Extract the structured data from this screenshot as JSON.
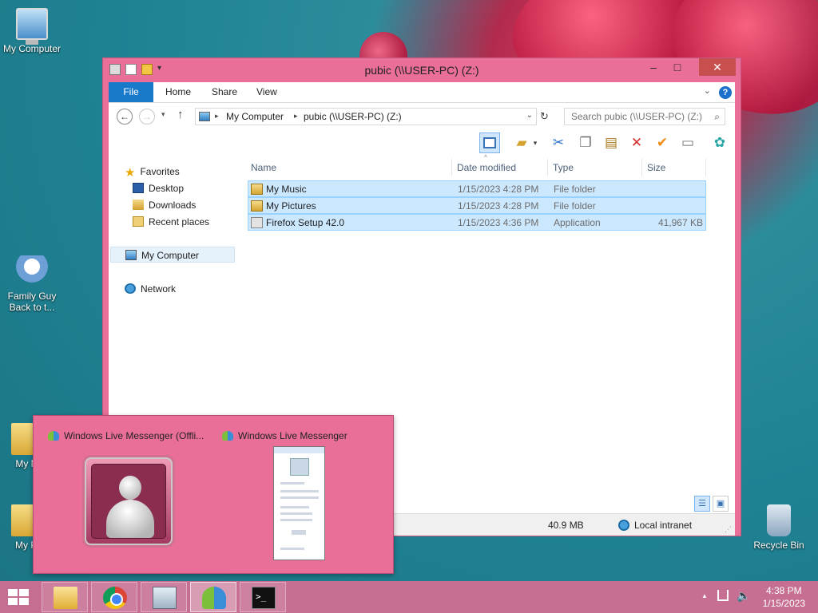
{
  "desktop": {
    "icons": [
      {
        "label": "My Computer"
      },
      {
        "label": "Family Guy Back to t..."
      },
      {
        "label": "My M"
      },
      {
        "label": "My Pi"
      },
      {
        "label": "Recycle Bin"
      }
    ]
  },
  "explorer": {
    "title": "pubic (\\\\USER-PC) (Z:)",
    "ribbon_tabs": [
      "File",
      "Home",
      "Share",
      "View"
    ],
    "address": {
      "parts": [
        "My Computer",
        "pubic (\\\\USER-PC) (Z:)"
      ]
    },
    "search": {
      "placeholder": "Search pubic (\\\\USER-PC) (Z:)"
    },
    "nav_pane": {
      "favorites": "Favorites",
      "desktop": "Desktop",
      "downloads": "Downloads",
      "recent": "Recent places",
      "computer": "My Computer",
      "network": "Network"
    },
    "columns": [
      "Name",
      "Date modified",
      "Type",
      "Size"
    ],
    "files": [
      {
        "name": "My Music",
        "date": "1/15/2023 4:28 PM",
        "type": "File folder",
        "size": "",
        "icon": "music-folder-icon"
      },
      {
        "name": "My Pictures",
        "date": "1/15/2023 4:28 PM",
        "type": "File folder",
        "size": "",
        "icon": "pictures-folder-icon"
      },
      {
        "name": "Firefox Setup 42.0",
        "date": "1/15/2023 4:36 PM",
        "type": "Application",
        "size": "41,967 KB",
        "icon": "installer-icon"
      }
    ],
    "status": {
      "size": "40.9 MB",
      "zone": "Local intranet"
    }
  },
  "thumbnails": {
    "items": [
      {
        "title": "Windows Live Messenger (Offli..."
      },
      {
        "title": "Windows Live Messenger"
      }
    ]
  },
  "taskbar": {
    "apps": [
      "file-explorer",
      "chrome",
      "remote-desktop",
      "windows-live-messenger",
      "command-prompt"
    ],
    "clock": {
      "time": "4:38 PM",
      "date": "1/15/2023"
    }
  },
  "colors": {
    "accent": "#e96f98",
    "file_tab": "#1979ca",
    "selection": "#cce8ff",
    "close": "#c7504e"
  }
}
